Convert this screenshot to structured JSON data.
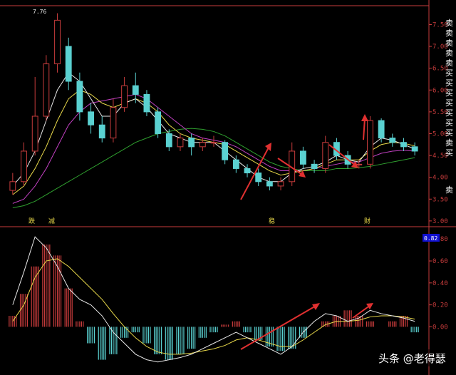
{
  "top_panel": {
    "y_ticks": [
      "7.50",
      "7.00",
      "6.50",
      "6.00",
      "5.50",
      "5.00",
      "4.50",
      "4.00",
      "3.50",
      "3.00"
    ],
    "peak_label": "7.76",
    "side_labels": [
      "卖",
      "卖",
      "卖",
      "卖",
      "卖",
      "买",
      "买",
      "买",
      "买",
      "买",
      "买",
      "买",
      "卖",
      "买",
      "卖"
    ],
    "markers": [
      "跌",
      "减",
      "稳",
      "财"
    ]
  },
  "bottom_panel": {
    "y_ticks": [
      "0.80",
      "0.60",
      "0.40",
      "0.20",
      "0.00"
    ],
    "indicator_value": "0.82"
  },
  "watermark": {
    "text": "头条 @老得瑟"
  },
  "colors": {
    "background": "#000000",
    "axis": "#c83c3c",
    "up_candle": "#c83c3c",
    "down_candle": "#5ad1d1",
    "ma_white": "#e8e8e8",
    "ma_yellow": "#e8d84a",
    "ma_magenta": "#c040c0",
    "ma_green": "#2fa02f",
    "arrow": "#e03030",
    "indicator_box": "#1010d0"
  },
  "chart_data": {
    "type": "candlestick",
    "price_axis": {
      "range": [
        2.9,
        7.9
      ]
    },
    "indicator_axis": {
      "range": [
        -0.4,
        0.86
      ]
    },
    "candles": [
      {
        "o": 3.7,
        "c": 3.9,
        "h": 4.1,
        "l": 3.6
      },
      {
        "o": 3.9,
        "c": 4.6,
        "h": 4.8,
        "l": 3.8
      },
      {
        "o": 4.6,
        "c": 5.4,
        "h": 6.3,
        "l": 4.5
      },
      {
        "o": 5.4,
        "c": 6.6,
        "h": 6.8,
        "l": 5.3
      },
      {
        "o": 6.6,
        "c": 7.6,
        "h": 7.76,
        "l": 6.4
      },
      {
        "o": 7.0,
        "c": 6.2,
        "h": 7.2,
        "l": 6.0
      },
      {
        "o": 6.2,
        "c": 5.5,
        "h": 6.4,
        "l": 5.3
      },
      {
        "o": 5.5,
        "c": 5.2,
        "h": 5.7,
        "l": 5.0
      },
      {
        "o": 5.2,
        "c": 4.9,
        "h": 5.4,
        "l": 4.8
      },
      {
        "o": 4.9,
        "c": 5.6,
        "h": 5.8,
        "l": 4.8
      },
      {
        "o": 5.6,
        "c": 6.1,
        "h": 6.3,
        "l": 5.5
      },
      {
        "o": 6.1,
        "c": 5.9,
        "h": 6.4,
        "l": 5.7
      },
      {
        "o": 5.9,
        "c": 5.5,
        "h": 6.0,
        "l": 5.4
      },
      {
        "o": 5.5,
        "c": 5.0,
        "h": 5.6,
        "l": 4.9
      },
      {
        "o": 5.0,
        "c": 4.7,
        "h": 5.1,
        "l": 4.6
      },
      {
        "o": 4.7,
        "c": 4.9,
        "h": 5.0,
        "l": 4.6
      },
      {
        "o": 4.9,
        "c": 4.7,
        "h": 5.0,
        "l": 4.5
      },
      {
        "o": 4.7,
        "c": 4.8,
        "h": 4.9,
        "l": 4.6
      },
      {
        "o": 4.8,
        "c": 4.8,
        "h": 4.95,
        "l": 4.7
      },
      {
        "o": 4.8,
        "c": 4.4,
        "h": 4.85,
        "l": 4.3
      },
      {
        "o": 4.4,
        "c": 4.2,
        "h": 4.5,
        "l": 4.1
      },
      {
        "o": 4.2,
        "c": 4.1,
        "h": 4.3,
        "l": 4.0
      },
      {
        "o": 4.1,
        "c": 3.9,
        "h": 4.2,
        "l": 3.8
      },
      {
        "o": 3.9,
        "c": 3.8,
        "h": 4.0,
        "l": 3.7
      },
      {
        "o": 3.8,
        "c": 3.9,
        "h": 4.0,
        "l": 3.7
      },
      {
        "o": 3.9,
        "c": 4.6,
        "h": 4.8,
        "l": 3.8
      },
      {
        "o": 4.6,
        "c": 4.3,
        "h": 4.7,
        "l": 4.2
      },
      {
        "o": 4.3,
        "c": 4.2,
        "h": 4.4,
        "l": 4.1
      },
      {
        "o": 4.2,
        "c": 4.8,
        "h": 4.95,
        "l": 4.1
      },
      {
        "o": 4.8,
        "c": 4.5,
        "h": 4.9,
        "l": 4.4
      },
      {
        "o": 4.5,
        "c": 4.3,
        "h": 4.6,
        "l": 4.2
      },
      {
        "o": 4.3,
        "c": 4.3,
        "h": 4.4,
        "l": 4.2
      },
      {
        "o": 4.3,
        "c": 5.3,
        "h": 5.4,
        "l": 4.2
      },
      {
        "o": 5.3,
        "c": 4.9,
        "h": 5.35,
        "l": 4.8
      },
      {
        "o": 4.9,
        "c": 4.8,
        "h": 5.0,
        "l": 4.7
      },
      {
        "o": 4.8,
        "c": 4.7,
        "h": 4.9,
        "l": 4.6
      },
      {
        "o": 4.7,
        "c": 4.6,
        "h": 4.8,
        "l": 4.5
      }
    ],
    "ma_white": [
      3.8,
      4.1,
      4.6,
      5.3,
      6.0,
      6.4,
      6.2,
      5.8,
      5.4,
      5.4,
      5.7,
      5.8,
      5.6,
      5.3,
      5.0,
      4.9,
      4.8,
      4.8,
      4.8,
      4.6,
      4.4,
      4.2,
      4.0,
      3.9,
      3.9,
      4.1,
      4.2,
      4.25,
      4.35,
      4.5,
      4.4,
      4.35,
      4.7,
      4.9,
      4.85,
      4.75,
      4.65
    ],
    "ma_yellow": [
      3.6,
      3.8,
      4.2,
      4.7,
      5.3,
      5.8,
      6.0,
      5.9,
      5.7,
      5.6,
      5.7,
      5.8,
      5.7,
      5.5,
      5.2,
      5.0,
      4.9,
      4.85,
      4.8,
      4.75,
      4.6,
      4.45,
      4.3,
      4.15,
      4.05,
      4.1,
      4.15,
      4.2,
      4.3,
      4.4,
      4.4,
      4.4,
      4.6,
      4.75,
      4.8,
      4.78,
      4.72
    ],
    "ma_magenta": [
      3.4,
      3.5,
      3.8,
      4.2,
      4.7,
      5.2,
      5.5,
      5.7,
      5.75,
      5.8,
      5.85,
      5.9,
      5.8,
      5.6,
      5.4,
      5.2,
      5.0,
      4.9,
      4.85,
      4.8,
      4.7,
      4.55,
      4.4,
      4.25,
      4.15,
      4.15,
      4.15,
      4.2,
      4.25,
      4.3,
      4.35,
      4.35,
      4.45,
      4.55,
      4.6,
      4.62,
      4.6
    ],
    "ma_green": [
      3.3,
      3.35,
      3.45,
      3.6,
      3.75,
      3.9,
      4.05,
      4.2,
      4.35,
      4.5,
      4.65,
      4.8,
      4.9,
      5.0,
      5.05,
      5.1,
      5.12,
      5.1,
      5.05,
      4.95,
      4.8,
      4.65,
      4.5,
      4.35,
      4.25,
      4.2,
      4.15,
      4.15,
      4.15,
      4.2,
      4.2,
      4.22,
      4.25,
      4.3,
      4.35,
      4.4,
      4.45
    ],
    "histogram": [
      0.1,
      0.3,
      0.55,
      0.75,
      0.65,
      0.35,
      0.05,
      -0.15,
      -0.3,
      -0.25,
      -0.1,
      -0.05,
      -0.15,
      -0.25,
      -0.3,
      -0.25,
      -0.2,
      -0.1,
      -0.05,
      0.02,
      0.05,
      -0.05,
      -0.12,
      -0.18,
      -0.22,
      -0.2,
      -0.1,
      0.0,
      0.05,
      0.1,
      0.15,
      0.1,
      0.05,
      0.0,
      0.05,
      0.1,
      -0.05
    ],
    "dif": [
      0.2,
      0.5,
      0.82,
      0.72,
      0.55,
      0.35,
      0.25,
      0.2,
      0.1,
      -0.05,
      -0.15,
      -0.25,
      -0.3,
      -0.32,
      -0.3,
      -0.28,
      -0.25,
      -0.2,
      -0.15,
      -0.1,
      -0.05,
      -0.1,
      -0.15,
      -0.2,
      -0.25,
      -0.18,
      -0.05,
      0.05,
      0.12,
      0.1,
      0.05,
      0.08,
      0.15,
      0.12,
      0.1,
      0.08,
      0.05
    ],
    "dea": [
      0.05,
      0.2,
      0.45,
      0.6,
      0.62,
      0.55,
      0.45,
      0.35,
      0.25,
      0.12,
      0.0,
      -0.1,
      -0.18,
      -0.23,
      -0.25,
      -0.25,
      -0.24,
      -0.22,
      -0.2,
      -0.17,
      -0.12,
      -0.1,
      -0.12,
      -0.15,
      -0.18,
      -0.18,
      -0.12,
      -0.05,
      0.02,
      0.05,
      0.05,
      0.06,
      0.09,
      0.1,
      0.1,
      0.09,
      0.07
    ]
  }
}
